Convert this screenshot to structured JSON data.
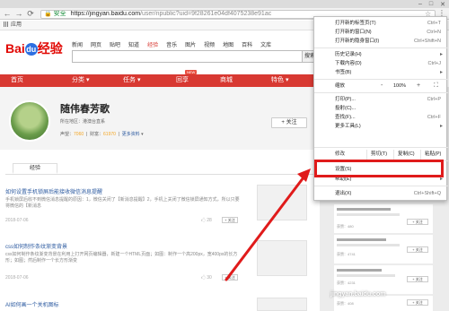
{
  "browser": {
    "url_secure_label": "安全",
    "url_host": "https://jingyan.baidu.com",
    "url_path": "/user/npublic?uid=9f28261e04df4075238e91ac",
    "bookmark_apps_label": "应用"
  },
  "site": {
    "logo_bai": "Bai",
    "logo_du": "du",
    "logo_jingyan": "经验",
    "top_nav": [
      "新闻",
      "网页",
      "贴吧",
      "知道",
      "经验",
      "音乐",
      "图片",
      "视频",
      "地图",
      "百科",
      "文库"
    ],
    "search_button": "搜索",
    "main_nav": [
      "首页",
      "分类",
      "任务",
      "回享",
      "商城",
      "特色"
    ],
    "new_badge": "NEW"
  },
  "profile": {
    "name": "随伟春芳歌",
    "region": "所在地区：港澳台直系",
    "stats_prefix_rep": "声望：",
    "rep_value": "7060",
    "stats_prefix_wealth": "财富：",
    "wealth_value": "61970",
    "more_info": "更多资料",
    "follow_button": "+ 关注",
    "tab_label": "经验"
  },
  "articles": [
    {
      "title": "如何设置手机锁屏后能接收微信消息提醒",
      "desc": "手机锁屏后收不到微信消息提醒的原因：1，微信关闭了【新消息提醒】2，手机上关闭了微信锁屏通知方式，所以只要将微信的【新消息",
      "date": "2018-07-06",
      "count": "28"
    },
    {
      "title": "css如何制作条纹渐变背景",
      "desc": "css如何制作条纹渐变背景在利用上打开网页编辑器，新建一个HTML页面；如图：制作一个高200px，宽400px的长方形；如图；然后制作一个长方形渐变",
      "date": "2018-07-06",
      "count": "30"
    },
    {
      "title": "AI如何画一个关机图标",
      "desc": "",
      "date": "",
      "count": ""
    }
  ],
  "article_follow_label": "+ 关注",
  "sidebar": {
    "cards": [
      {
        "meta": "获赞：480",
        "follow": "+ 关注"
      },
      {
        "meta": "获赞：4741",
        "follow": "+ 关注"
      },
      {
        "meta": "获赞：4231",
        "follow": "+ 关注"
      },
      {
        "meta": "获赞：408",
        "follow": "+ 关注"
      }
    ],
    "watermark": "jingyan.baidu.com"
  },
  "chrome_menu": {
    "items": [
      {
        "label": "打开新的标签页(T)",
        "shortcut": "Ctrl+T"
      },
      {
        "label": "打开新的窗口(N)",
        "shortcut": "Ctrl+N"
      },
      {
        "label": "打开新的隐身窗口(I)",
        "shortcut": "Ctrl+Shift+N"
      },
      {
        "label": "历史记录(H)",
        "shortcut": ""
      },
      {
        "label": "下载内容(D)",
        "shortcut": "Ctrl+J"
      },
      {
        "label": "书签(B)",
        "shortcut": ""
      },
      {
        "label": "打印(P)...",
        "shortcut": "Ctrl+P"
      },
      {
        "label": "投射(C)...",
        "shortcut": ""
      },
      {
        "label": "查找(F)...",
        "shortcut": "Ctrl+F"
      },
      {
        "label": "更多工具(L)",
        "shortcut": ""
      },
      {
        "label": "设置(S)",
        "shortcut": ""
      },
      {
        "label": "帮助(E)",
        "shortcut": ""
      },
      {
        "label": "退出(X)",
        "shortcut": "Ctrl+Shift+Q"
      }
    ],
    "zoom_label": "缩放",
    "zoom_minus": "-",
    "zoom_value": "100%",
    "zoom_plus": "+",
    "edit_label": "修改",
    "cut_label": "剪切(T)",
    "copy_label": "复制(C)",
    "paste_label": "粘贴(P)"
  }
}
